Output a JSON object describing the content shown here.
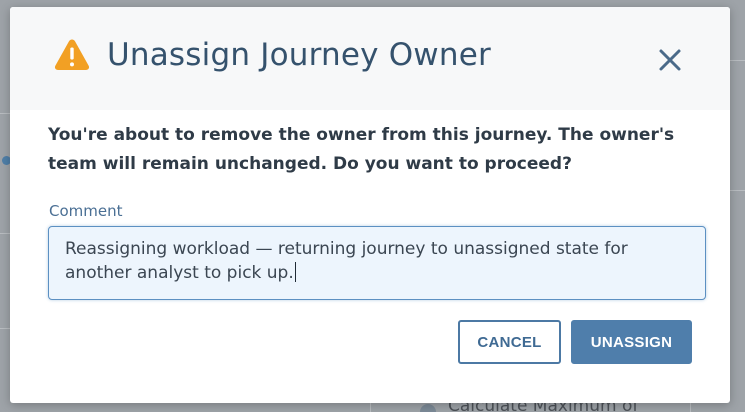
{
  "background": {
    "peek_text": "Calculate Maximum of"
  },
  "dialog": {
    "title": "Unassign Journey Owner",
    "title_icon": "warning-triangle-icon",
    "close_icon": "close-icon",
    "message": "You're about to remove the owner from this journey. The owner's team will remain unchanged. Do you want to proceed?",
    "comment": {
      "label": "Comment",
      "value": "Reassigning workload — returning journey to unassigned state for another analyst to pick up."
    },
    "buttons": {
      "cancel_label": "CANCEL",
      "confirm_label": "UNASSIGN"
    }
  },
  "colors": {
    "accent": "#4f7eab",
    "title": "#35526d",
    "warning": "#f2a024",
    "field_background": "#edf5fd"
  }
}
